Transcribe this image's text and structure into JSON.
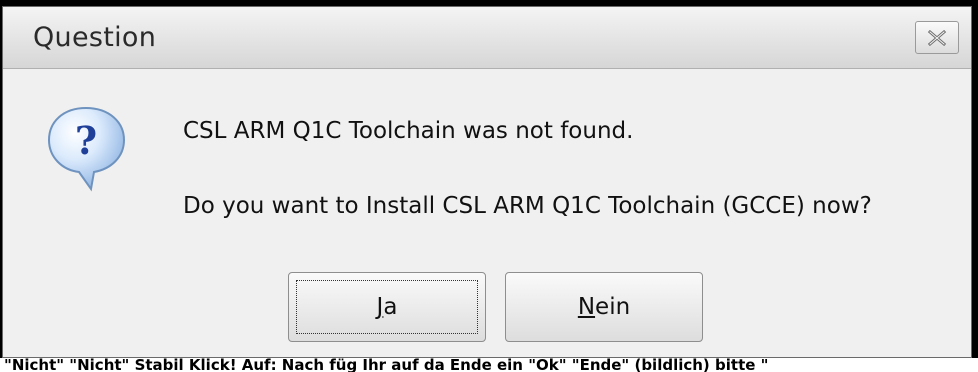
{
  "dialog": {
    "title": "Question",
    "icon": "question-icon",
    "message_line1": "CSL ARM Q1C Toolchain was not found.",
    "message_line2": "Do you want to Install CSL ARM Q1C Toolchain (GCCE) now?",
    "buttons": {
      "yes": {
        "mnemonic": "J",
        "rest": "a"
      },
      "no": {
        "mnemonic": "N",
        "rest": "ein"
      }
    }
  },
  "background_text": "\"Nicht\" \"Nicht\" Stabil Klick! Auf: Nach füg Ihr auf da Ende ein \"Ok\" \"Ende\" (bildlich) bitte \""
}
